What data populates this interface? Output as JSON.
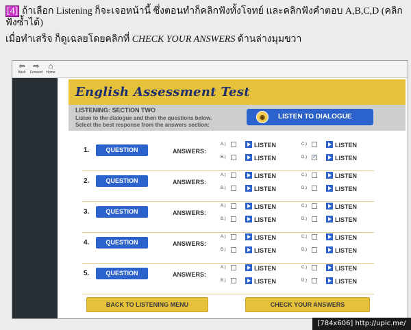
{
  "instructions": {
    "step_badge": "[4]",
    "line1": "ถ้าเลือก Listening ก็จะเจอหน้านี้  ซึ่งตอนทำก็คลิกฟังทั้งโจทย์  และคลิกฟังคำตอบ A,B,C,D (คลิกฟังซ้ำได้)",
    "line2_before": "เมื่อทำเสร็จ ก็ดูเฉลยโดยคลิกที่ ",
    "line2_em": "CHECK YOUR ANSWERS",
    "line2_after": " ด้านล่างมุมขวา"
  },
  "browser": {
    "back": "Back",
    "forward": "Forward",
    "home": "Home"
  },
  "app": {
    "title": "English Assessment Test",
    "section_title": "LISTENING: SECTION TWO",
    "section_desc1": "Listen to the dialogue and then the questions below.",
    "section_desc2": "Select the best response from the answers section:",
    "listen_dialogue": "LISTEN TO DIALOGUE",
    "question_label": "QUESTION",
    "answers_label": "ANSWERS:",
    "listen_label": "LISTEN",
    "option_letters": [
      "A.)",
      "B.)",
      "C.)",
      "D.)"
    ],
    "questions": [
      {
        "num": "1.",
        "checked": "D"
      },
      {
        "num": "2.",
        "checked": ""
      },
      {
        "num": "3.",
        "checked": ""
      },
      {
        "num": "4.",
        "checked": ""
      },
      {
        "num": "5.",
        "checked": ""
      }
    ],
    "back_menu": "BACK TO LISTENING MENU",
    "check_answers": "CHECK YOUR ANSWERS"
  },
  "watermark": "[784x606] http://upic.me/"
}
